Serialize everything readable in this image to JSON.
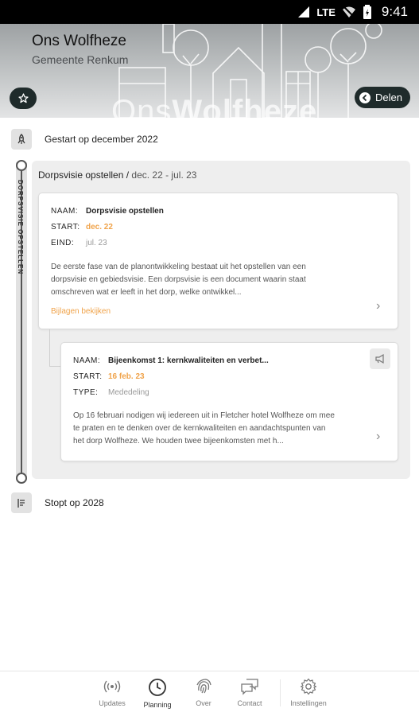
{
  "statusbar": {
    "network": "LTE",
    "time": "9:41"
  },
  "header": {
    "title": "Ons Wolfheze",
    "subtitle": "Gemeente Renkum",
    "watermark_light": "Ons",
    "watermark_bold": "Wolfheze",
    "share_label": "Delen"
  },
  "timeline": {
    "start_label": "Gestart op december 2022",
    "end_label": "Stopt op 2028",
    "phase": {
      "vertical_label": "DORPSVISIE OPSTELLEN",
      "title": "Dorpsvisie opstellen",
      "separator": " / ",
      "dates": "dec. 22 - jul. 23"
    }
  },
  "card1": {
    "name_key": "NAAM:",
    "name": "Dorpsvisie opstellen",
    "start_key": "START:",
    "start": "dec. 22",
    "end_key": "EIND:",
    "end": "jul. 23",
    "desc_line1": "De eerste fase van de planontwikkeling bestaat uit het opstellen van een",
    "desc_line2": "dorpsvisie en gebiedsvisie. Een dorpsvisie is een document waarin staat",
    "desc_line3": "omschreven wat er leeft in het dorp, welke ontwikkel...",
    "link": "Bijlagen bekijken"
  },
  "card2": {
    "name_key": "NAAM:",
    "name": "Bijeenkomst 1: kernkwaliteiten en verbet...",
    "start_key": "START:",
    "start": "16 feb. 23",
    "type_key": "TYPE:",
    "type": "Mededeling",
    "desc_line1": "Op 16 februari nodigen wij iedereen uit in Fletcher hotel Wolfheze om mee",
    "desc_line2": "te praten en te denken over de kernkwaliteiten en aandachtspunten van",
    "desc_line3": "het dorp Wolfheze. We houden twee bijeenkomsten met h..."
  },
  "nav": {
    "items": [
      {
        "label": "Updates",
        "icon": "broadcast-icon"
      },
      {
        "label": "Planning",
        "icon": "clock-icon"
      },
      {
        "label": "Over",
        "icon": "fingerprint-icon"
      },
      {
        "label": "Contact",
        "icon": "chat-icon"
      },
      {
        "label": "Instellingen",
        "icon": "gear-icon"
      }
    ],
    "active": "Planning"
  },
  "colors": {
    "accent": "#f0a34a",
    "dark_button": "#1f2b2b",
    "header_bg": "#b8bcbe"
  }
}
